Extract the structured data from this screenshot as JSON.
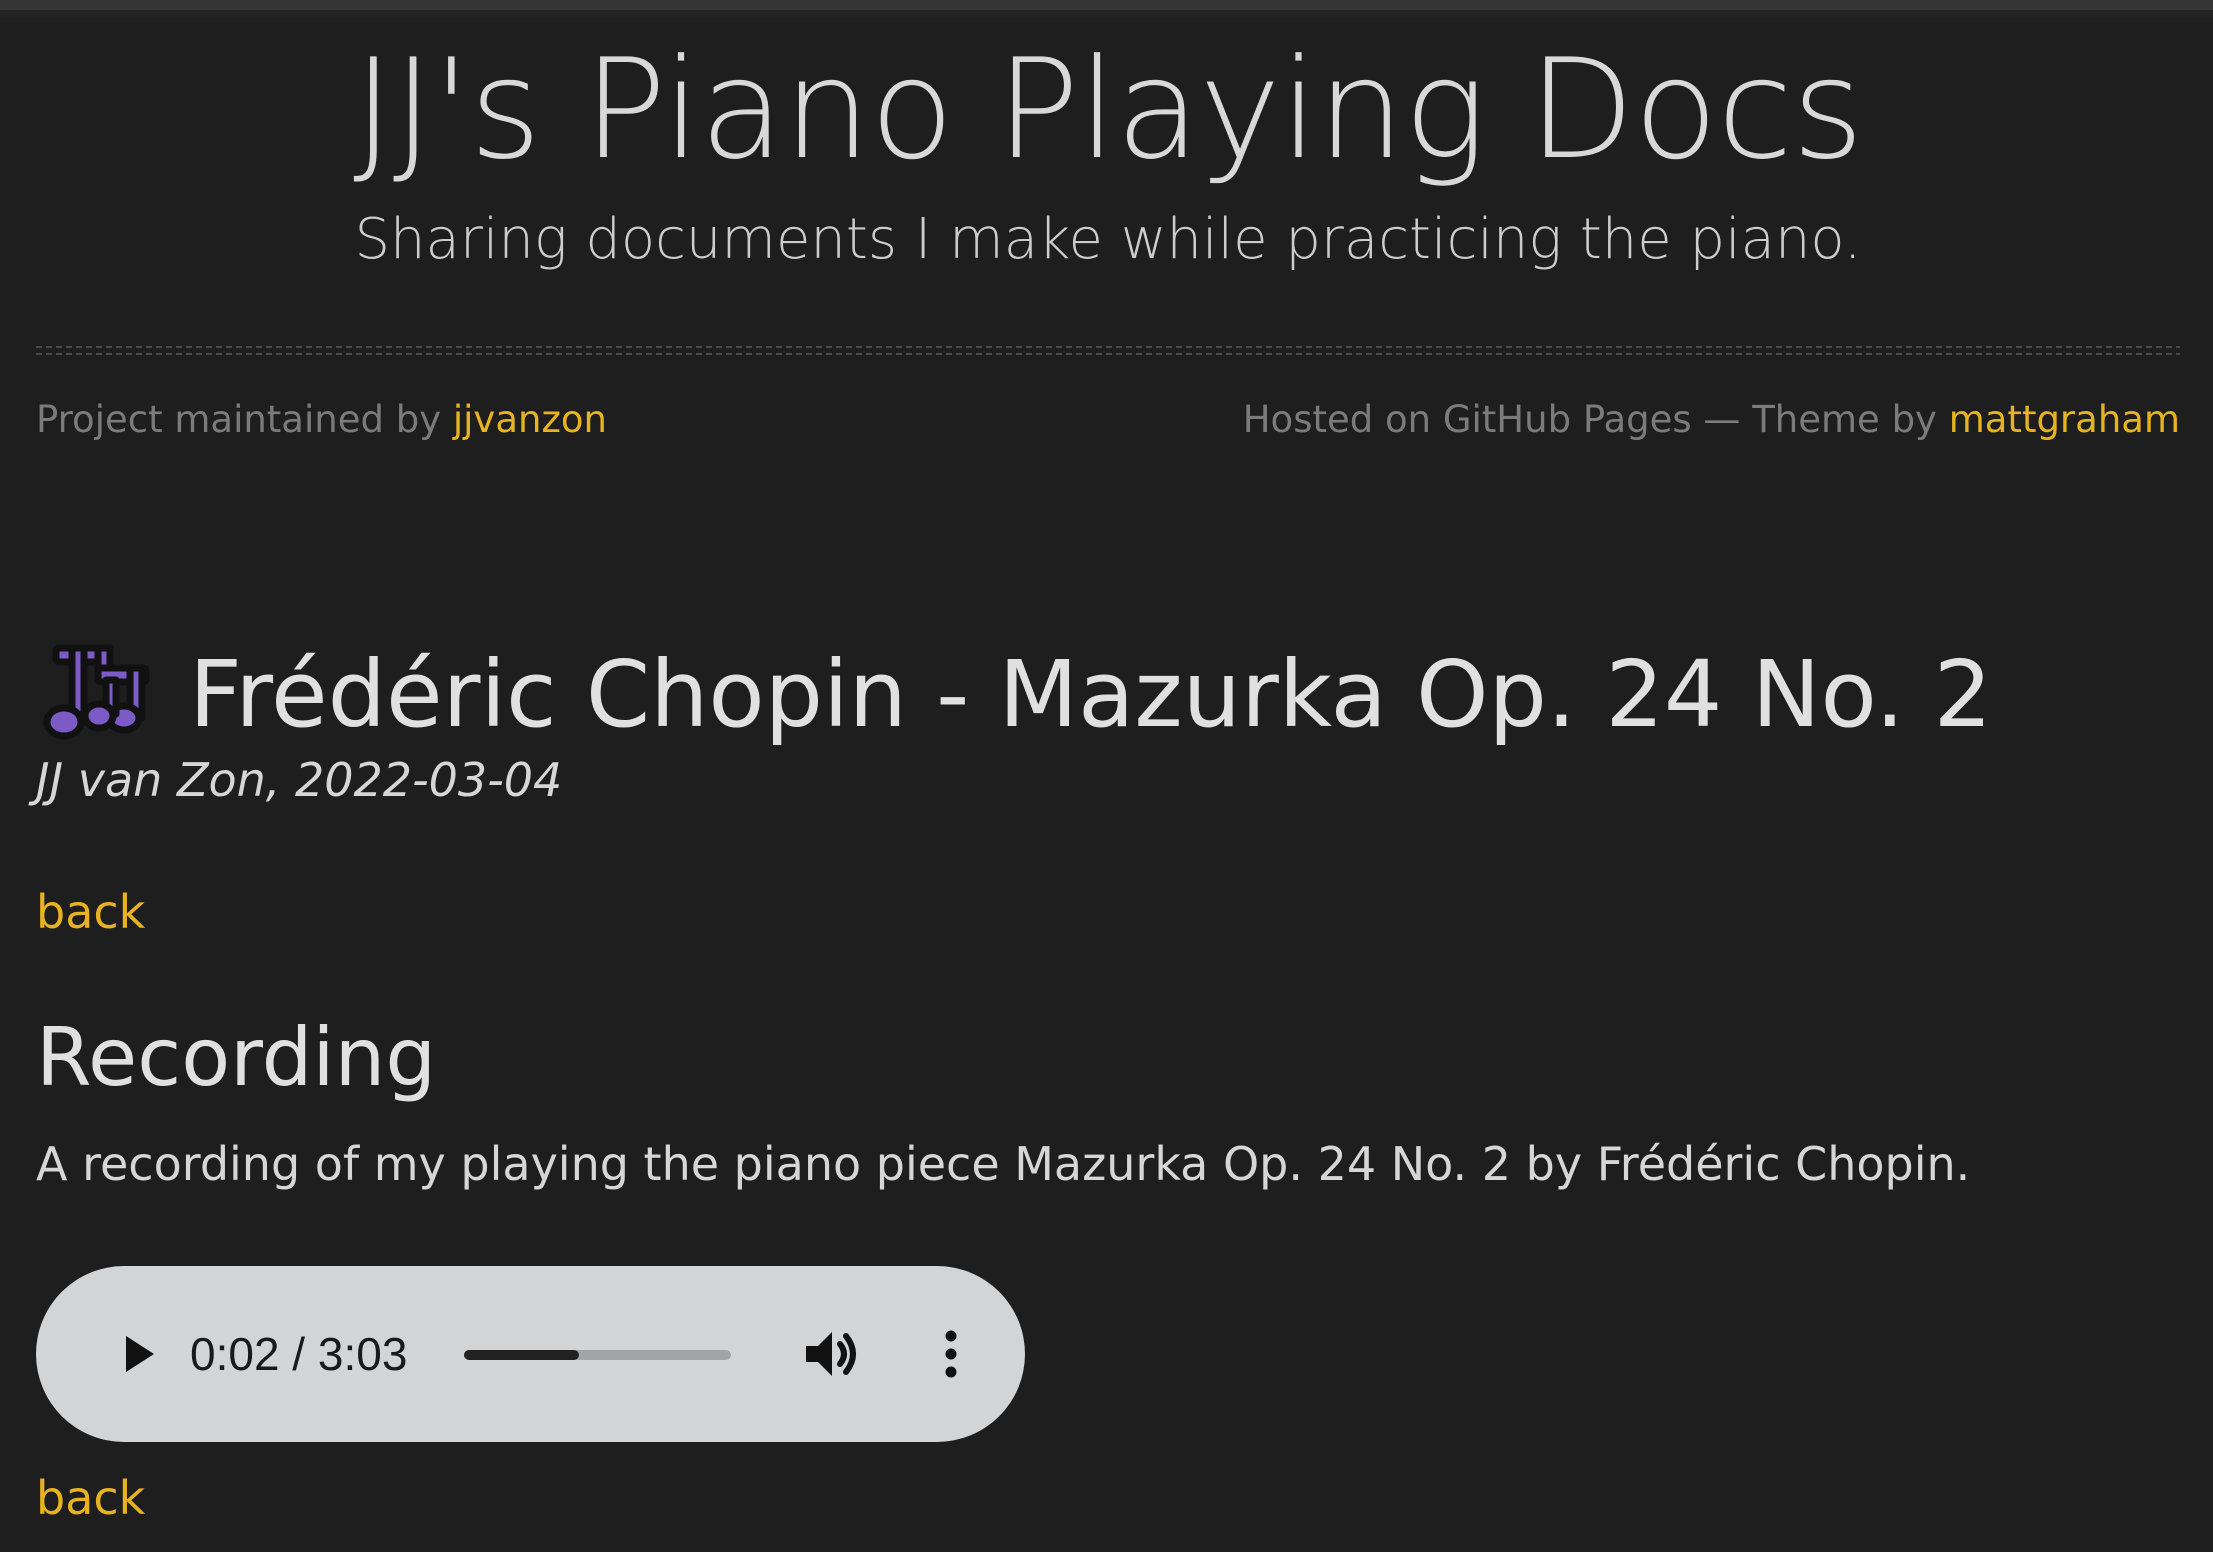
{
  "header": {
    "title": "JJ's Piano Playing Docs",
    "tagline": "Sharing documents I make while practicing the piano.",
    "maintained_prefix": "Project maintained by ",
    "maintainer": "jjvanzon",
    "hosted_prefix": "Hosted on GitHub Pages — Theme by ",
    "theme_author": "mattgraham"
  },
  "page": {
    "icon": "music-notes-icon",
    "title": "Frédéric Chopin - Mazurka Op. 24 No. 2",
    "byline": "JJ van Zon, 2022-03-04",
    "back_label": "back",
    "section_heading": "Recording",
    "section_text": "A recording of my playing the piano piece Mazurka Op. 24 No. 2 by Frédéric Chopin.",
    "back_label_bottom": "back"
  },
  "audio": {
    "time_text": "0:02 / 3:03",
    "progress_fraction": 0.43,
    "play_icon": "play-icon",
    "volume_icon": "volume-icon",
    "more_icon": "more-vertical-icon"
  },
  "colors": {
    "background": "#1e1e1e",
    "link": "#e8b320",
    "icon_purple": "#7d5bc6",
    "player_bg": "#d3d4d6"
  }
}
